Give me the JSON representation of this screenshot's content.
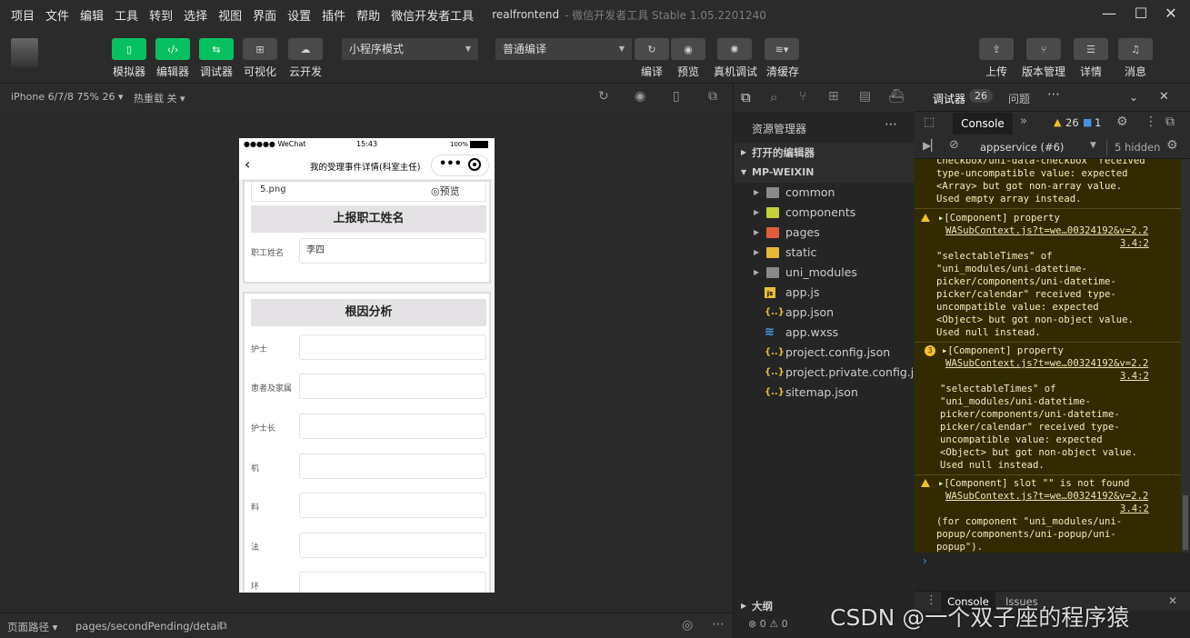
{
  "menubar": {
    "items": [
      "项目",
      "文件",
      "编辑",
      "工具",
      "转到",
      "选择",
      "视图",
      "界面",
      "设置",
      "插件",
      "帮助",
      "微信开发者工具"
    ],
    "app_title": "realfrontend",
    "app_subtitle": "- 微信开发者工具 Stable 1.05.2201240"
  },
  "toolbar": {
    "left_buttons": [
      {
        "label": "模拟器",
        "icon": "phone-icon",
        "active": true
      },
      {
        "label": "编辑器",
        "icon": "code-icon",
        "active": true
      },
      {
        "label": "调试器",
        "icon": "debug-icon",
        "active": true
      },
      {
        "label": "可视化",
        "icon": "layout-icon",
        "active": false
      },
      {
        "label": "云开发",
        "icon": "cloud-icon",
        "active": false
      }
    ],
    "mode_select": "小程序模式",
    "compile_select": "普通编译",
    "mid_buttons": [
      {
        "label": "编译",
        "icon": "refresh-icon"
      },
      {
        "label": "预览",
        "icon": "eye-icon"
      },
      {
        "label": "真机调试",
        "icon": "bug-icon"
      },
      {
        "label": "清缓存",
        "icon": "layers-icon"
      }
    ],
    "right_buttons": [
      {
        "label": "上传",
        "icon": "upload-icon"
      },
      {
        "label": "版本管理",
        "icon": "branch-icon"
      },
      {
        "label": "详情",
        "icon": "menu-icon"
      },
      {
        "label": "消息",
        "icon": "bell-icon"
      }
    ],
    "accent_color": "#07c160"
  },
  "simulator": {
    "device": "iPhone 6/7/8 75% 26",
    "hot_reload": "热重载 关",
    "status": {
      "carrier": "●●●●● WeChat",
      "time": "15:43",
      "battery": "100%"
    },
    "nav_title": "我的受理事件详情(科室主任)",
    "attachment": {
      "file": "5.png",
      "preview": "预览"
    },
    "section1": {
      "title": "上报职工姓名",
      "fields": [
        {
          "label": "职工姓名",
          "value": "李四"
        }
      ]
    },
    "section2": {
      "title": "根因分析",
      "fields": [
        {
          "label": "护士",
          "value": ""
        },
        {
          "label": "患者及家属",
          "value": ""
        },
        {
          "label": "护士长",
          "value": ""
        },
        {
          "label": "机",
          "value": ""
        },
        {
          "label": "料",
          "value": ""
        },
        {
          "label": "法",
          "value": ""
        },
        {
          "label": "环",
          "value": ""
        }
      ]
    }
  },
  "statusbar": {
    "page_path_label": "页面路径",
    "page_path": "pages/secondPending/detail"
  },
  "explorer": {
    "title": "资源管理器",
    "open_editors": "打开的编辑器",
    "root": "MP-WEIXIN",
    "folders": [
      {
        "name": "common",
        "color": "#8a8a8a"
      },
      {
        "name": "components",
        "color": "#c5cf3b"
      },
      {
        "name": "pages",
        "color": "#e05d3a"
      },
      {
        "name": "static",
        "color": "#e8b73a"
      },
      {
        "name": "uni_modules",
        "color": "#8a8a8a"
      }
    ],
    "files": [
      {
        "name": "app.js",
        "type": "js"
      },
      {
        "name": "app.json",
        "type": "json"
      },
      {
        "name": "app.wxss",
        "type": "css"
      },
      {
        "name": "project.config.json",
        "type": "json"
      },
      {
        "name": "project.private.config.js...",
        "type": "json"
      },
      {
        "name": "sitemap.json",
        "type": "json"
      }
    ],
    "outline": "大纲",
    "errors": "0",
    "warnings": "0"
  },
  "debugger": {
    "tab_debugger": "调试器",
    "tab_count": "26",
    "tab_issues": "问题",
    "console_tab": "Console",
    "warn_count": "26",
    "info_count": "1",
    "context": "appservice (#6)",
    "hidden": "5 hidden",
    "messages": [
      {
        "lines": [
          "checkbox/uni-data-checkbox\" received",
          "type-uncompatible value: expected",
          "<Array> but got non-array value.",
          "Used empty array instead."
        ],
        "icon": "none"
      },
      {
        "head": "▸[Component] property",
        "link": "WASubContext.js?t=we…00324192&v=2.2",
        "link2": "3.4:2",
        "lines": [
          "\"selectableTimes\" of",
          "\"uni_modules/uni-datetime-",
          "picker/components/uni-datetime-",
          "picker/calendar\" received type-",
          "uncompatible value: expected",
          "<Object> but got non-object value.",
          "Used null instead."
        ],
        "icon": "warn"
      },
      {
        "head": "▸[Component] property",
        "link": "WASubContext.js?t=we…00324192&v=2.2",
        "link2": "3.4:2",
        "lines": [
          "\"selectableTimes\" of",
          "\"uni_modules/uni-datetime-",
          "picker/components/uni-datetime-",
          "picker/calendar\" received type-",
          "uncompatible value: expected",
          "<Object> but got non-object value.",
          "Used null instead."
        ],
        "icon": "badge",
        "badge": "3"
      },
      {
        "head": "▸[Component] slot \"\" is not found",
        "link": "WASubContext.js?t=we…00324192&v=2.2",
        "link2": "3.4:2",
        "lines": [
          "(for component \"uni_modules/uni-",
          "popup/components/uni-popup/uni-",
          "popup\")."
        ],
        "icon": "warn"
      }
    ],
    "drawer_tabs": [
      "Console",
      "Issues"
    ]
  },
  "watermark": "CSDN @一个双子座的程序猿"
}
